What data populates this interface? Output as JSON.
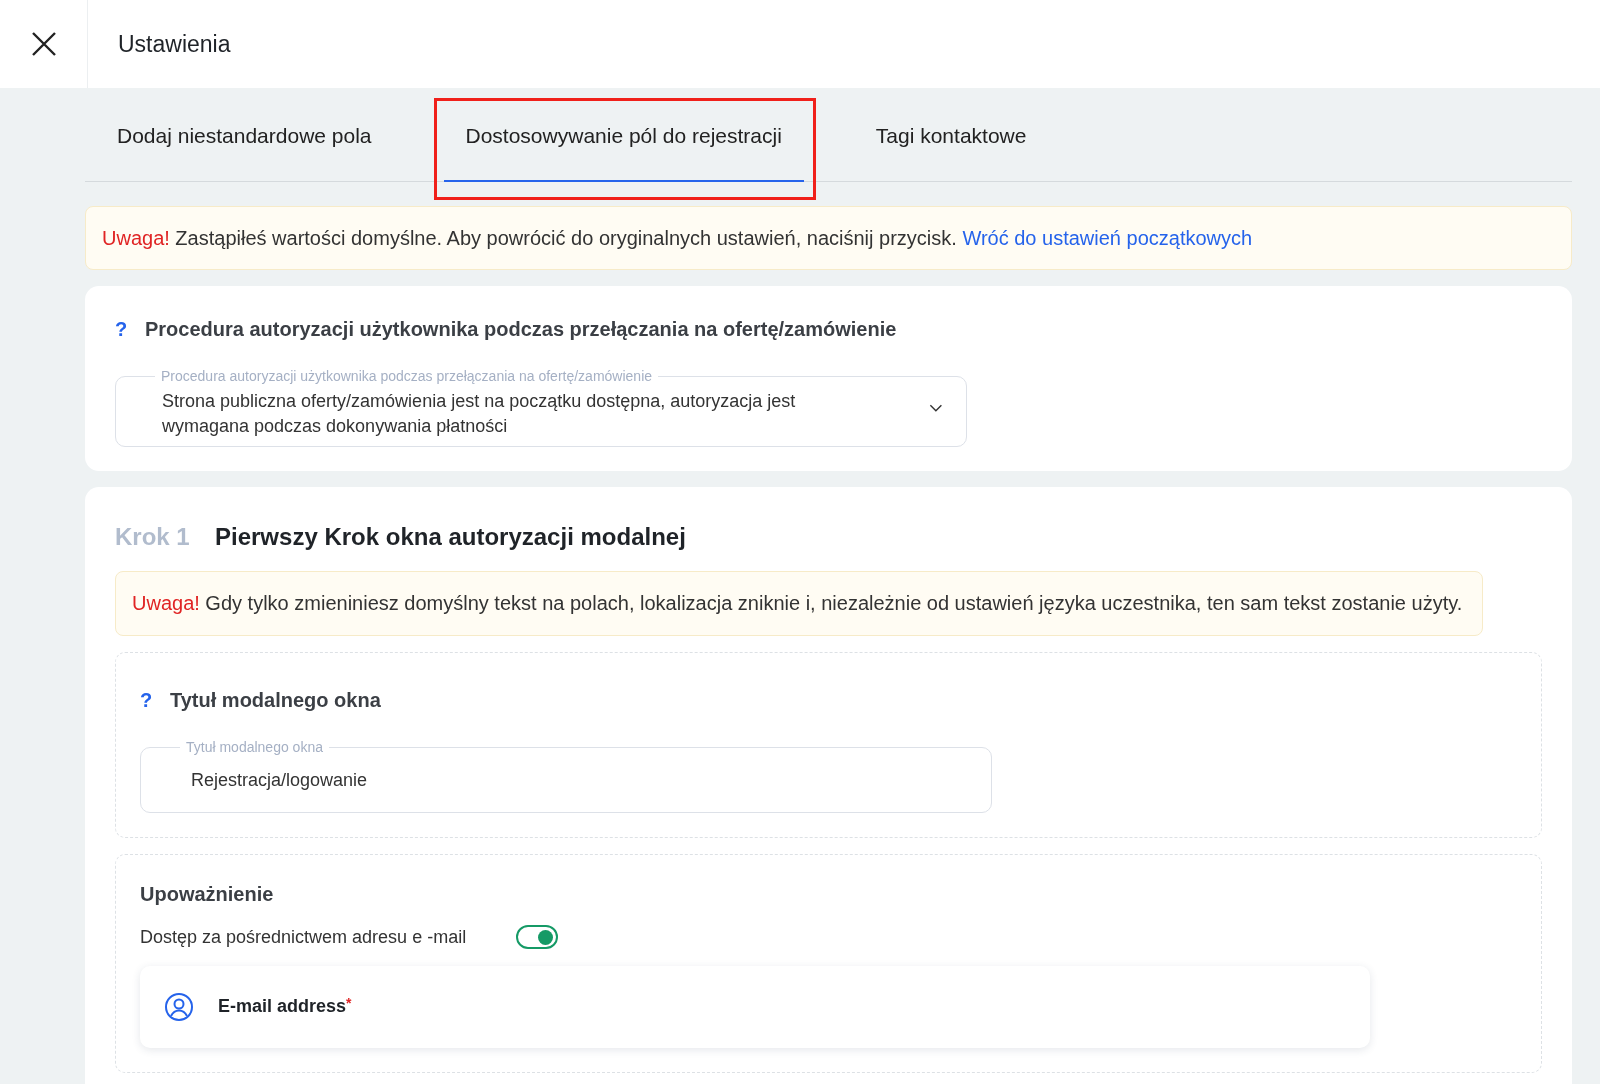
{
  "header": {
    "title": "Ustawienia"
  },
  "tabs": [
    {
      "label": "Dodaj niestandardowe pola",
      "selected": false,
      "highlighted": false
    },
    {
      "label": "Dostosowywanie pól do rejestracji",
      "selected": true,
      "highlighted": true
    },
    {
      "label": "Tagi kontaktowe",
      "selected": false,
      "highlighted": false
    }
  ],
  "notice": {
    "label": "Uwaga!",
    "text": "Zastąpiłeś wartości domyślne. Aby powrócić do oryginalnych ustawień, naciśnij przycisk.",
    "link": "Wróć do ustawień początkowych"
  },
  "auth_procedure": {
    "help": "?",
    "title": "Procedura autoryzacji użytkownika podczas przełączania na ofertę/zamówienie",
    "select": {
      "label": "Procedura autoryzacji użytkownika podczas przełączania na ofertę/zamówienie",
      "value": "Strona publiczna oferty/zamówienia jest na początku dostępna, autoryzacja jest wymagana podczas dokonywania płatności"
    }
  },
  "step": {
    "number": "Krok 1",
    "title": "Pierwszy Krok okna autoryzacji modalnej",
    "notice": {
      "label": "Uwaga!",
      "text": "Gdy tylko zmieniniesz domyślny tekst na polach, lokalizacja zniknie i, niezależnie od ustawień języka uczestnika, ten sam tekst zostanie użyty."
    },
    "modal_title": {
      "help": "?",
      "title": "Tytuł modalnego okna",
      "field": {
        "label": "Tytuł modalnego okna",
        "value": "Rejestracja/logowanie"
      }
    },
    "authorization": {
      "title": "Upoważnienie",
      "toggle": {
        "label": "Dostęp za pośrednictwem adresu e -mail",
        "on": true
      },
      "fields": [
        {
          "label": "E-mail address",
          "required_mark": "*"
        }
      ]
    }
  }
}
